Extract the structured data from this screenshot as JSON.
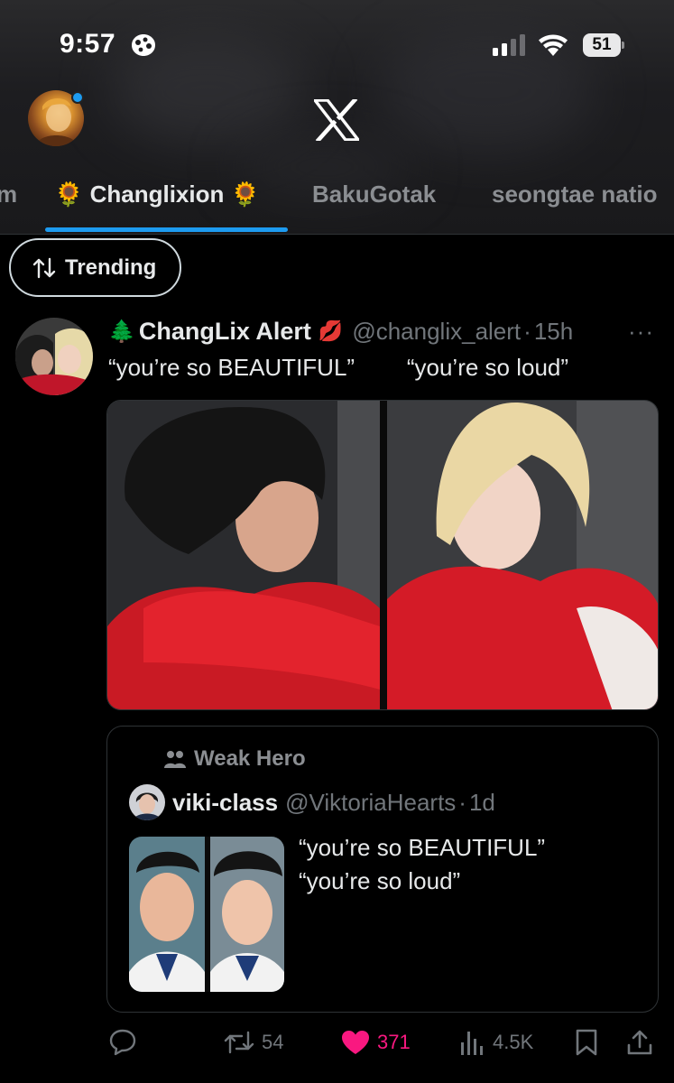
{
  "status_bar": {
    "time": "9:57",
    "battery": "51"
  },
  "tabs": {
    "items": [
      {
        "label": "m",
        "active": false
      },
      {
        "label": "🌻 Changlixion 🌻",
        "active": true
      },
      {
        "label": "BakuGotak",
        "active": false
      },
      {
        "label": "seongtae natio",
        "active": false
      }
    ]
  },
  "sort": {
    "label": "Trending"
  },
  "post": {
    "name_prefix_emoji": "🌲",
    "author_name": "ChangLix Alert",
    "name_suffix_emoji": "💋",
    "handle": "@changlix_alert",
    "separator": "·",
    "time_ago": "15h",
    "more": "···",
    "text": "“you’re so BEAUTIFUL”        “you’re so loud”"
  },
  "quote": {
    "community": "Weak Hero",
    "author_name": "viki-class",
    "handle": "@ViktoriaHearts",
    "separator": "·",
    "time_ago": "1d",
    "text": "“you’re so BEAUTIFUL”\n“you’re so loud”"
  },
  "actions": {
    "replies": "",
    "reposts": "54",
    "likes": "371",
    "views": "4.5K"
  },
  "colors": {
    "accent": "#1d9bf0",
    "like": "#f91880",
    "muted": "#71767b",
    "text": "#e7e9ea",
    "background": "#000000"
  },
  "icons": {
    "status": [
      "cookie-icon",
      "signal-icon",
      "wifi-icon",
      "battery-icon"
    ],
    "header": [
      "x-logo-icon"
    ],
    "sort": [
      "sort-arrows-icon"
    ],
    "actions": [
      "reply-icon",
      "repost-icon",
      "heart-icon",
      "views-icon",
      "bookmark-icon",
      "share-icon"
    ]
  }
}
